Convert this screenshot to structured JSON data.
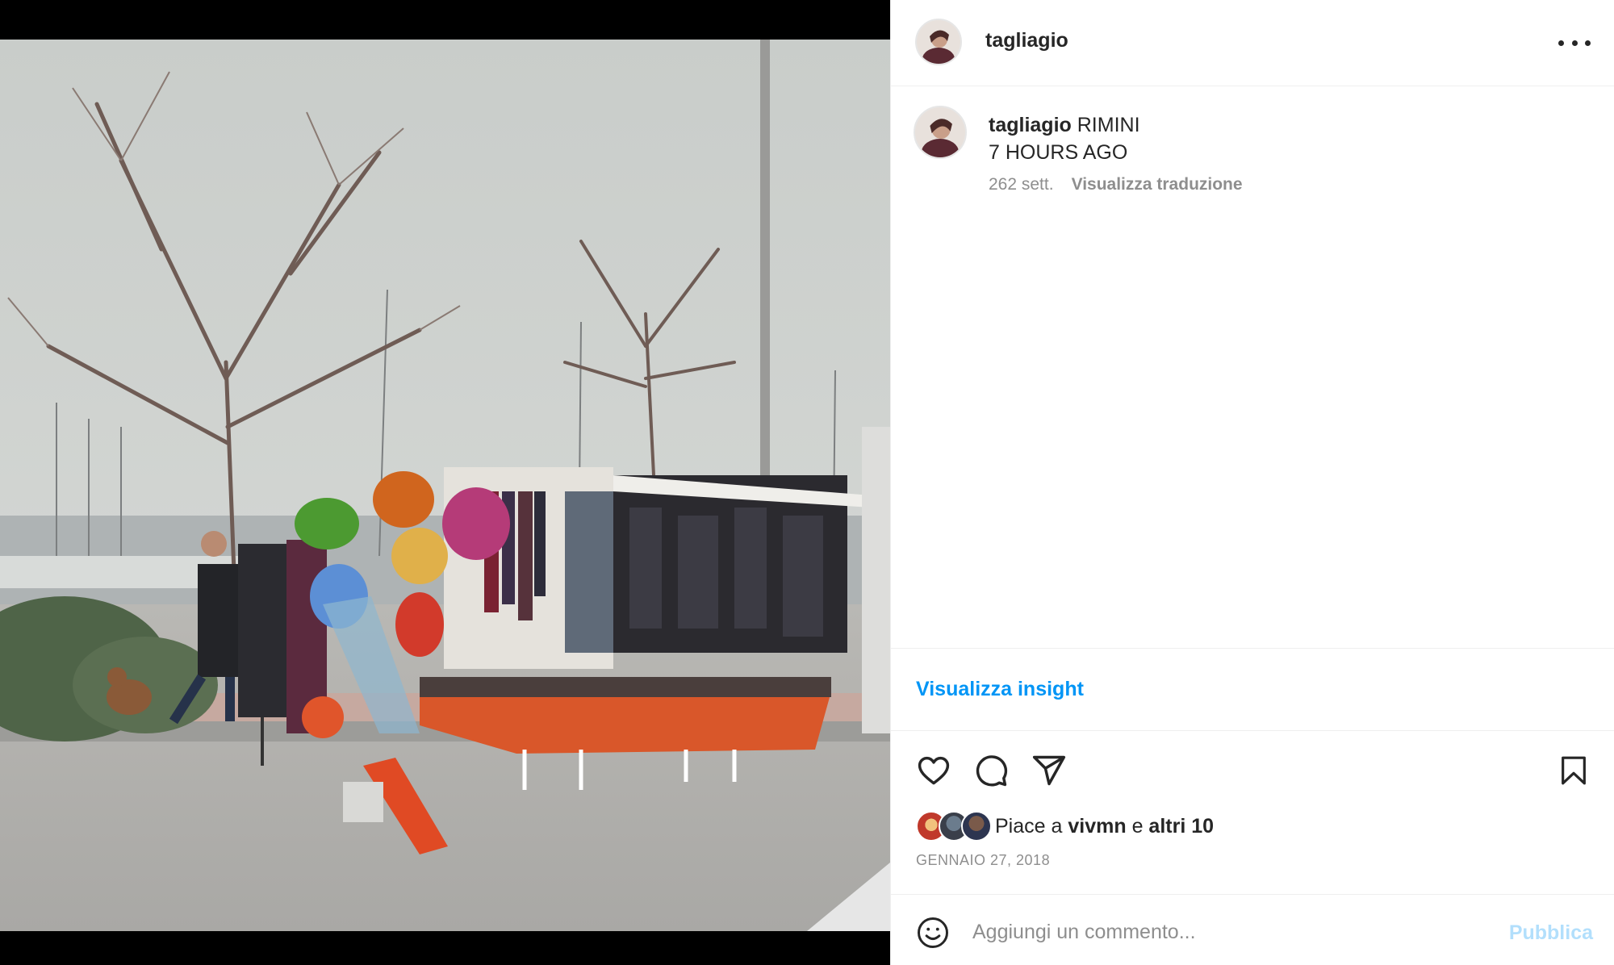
{
  "post": {
    "username": "tagliagio",
    "caption_user": "tagliagio",
    "caption_text": "RIMINI",
    "caption_line2": "7 HOURS AGO",
    "age": "262 sett.",
    "translate_label": "Visualizza traduzione",
    "insight_label": "Visualizza insight",
    "likes_prefix": "Piace a",
    "likes_user": "vivmn",
    "likes_conjunction": "e",
    "likes_others": "altri 10",
    "date": "GENNAIO 27, 2018"
  },
  "comment": {
    "placeholder": "Aggiungi un commento...",
    "publish_label": "Pubblica"
  },
  "icons": {
    "more": "more-horizontal-icon",
    "like": "heart-icon",
    "comment": "comment-bubble-icon",
    "share": "paper-plane-icon",
    "save": "bookmark-icon",
    "emoji": "smiley-icon"
  },
  "colors": {
    "link_blue": "#0095f6",
    "publish_disabled": "#b2dffc",
    "secondary_text": "#8e8e8e",
    "primary_text": "#262626",
    "divider": "#efefef"
  }
}
